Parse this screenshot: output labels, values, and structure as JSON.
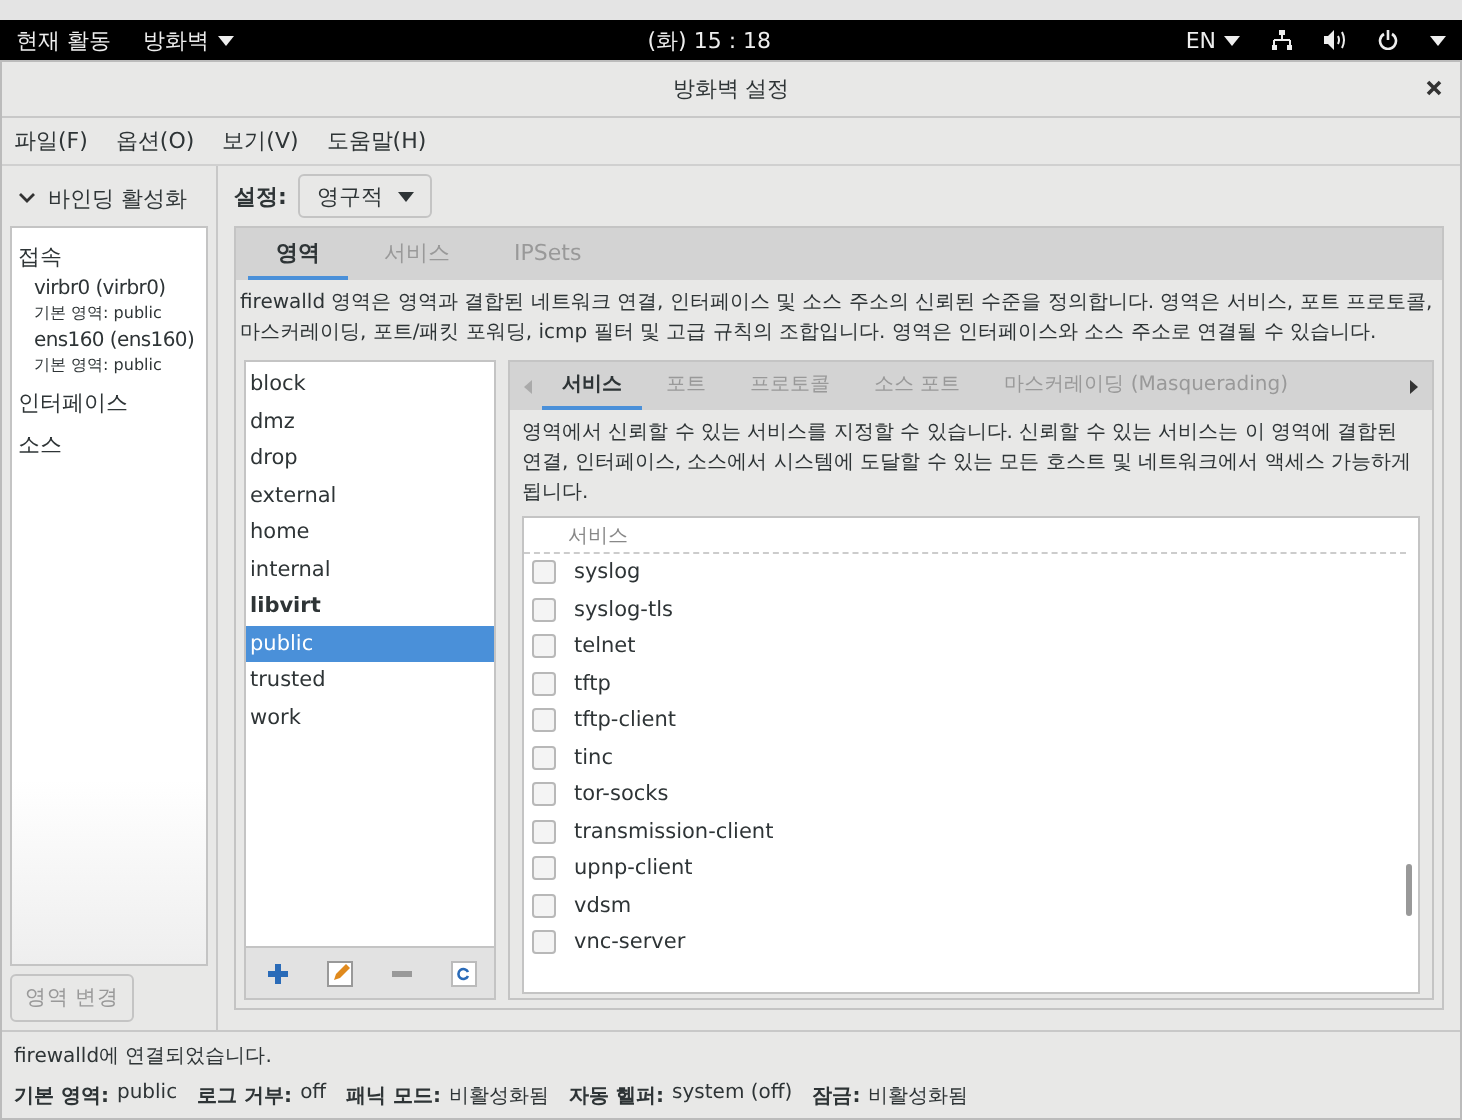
{
  "top_bar": {
    "activities": "현재 활동",
    "app": "방화벽",
    "clock": "(화) 15 : 18",
    "lang": "EN"
  },
  "window": {
    "title": "방화벽 설정"
  },
  "menu": [
    "파일(F)",
    "옵션(O)",
    "보기(V)",
    "도움말(H)"
  ],
  "binding": {
    "label": "바인딩 활성화",
    "expanded": true
  },
  "sidebar": [
    {
      "label": "접속",
      "children": [
        {
          "name": "virbr0 (virbr0)",
          "zone_label": "기본 영역:",
          "zone": "public"
        },
        {
          "name": "ens160 (ens160)",
          "zone_label": "기본 영역:",
          "zone": "public"
        }
      ]
    },
    {
      "label": "인터페이스"
    },
    {
      "label": "소스"
    }
  ],
  "change_zone_button": {
    "label": "영역 변경",
    "disabled": true
  },
  "config": {
    "label": "설정:",
    "value": "영구적"
  },
  "tabs": [
    {
      "label": "영역",
      "selected": true
    },
    {
      "label": "서비스",
      "selected": false
    },
    {
      "label": "IPSets",
      "selected": false
    }
  ],
  "zones_description": "firewalld 영역은 영역과 결합된 네트워크 연결, 인터페이스 및 소스 주소의 신뢰된 수준을 정의합니다. 영역은 서비스, 포트 프로토콜, 마스커레이딩, 포트/패킷 포워딩, icmp 필터 및 고급 규칙의 조합입니다. 영역은 인터페이스와 소스 주소로 연결될 수 있습니다.",
  "zones": [
    {
      "name": "block",
      "selected": false,
      "bold": false
    },
    {
      "name": "dmz",
      "selected": false,
      "bold": false
    },
    {
      "name": "drop",
      "selected": false,
      "bold": false
    },
    {
      "name": "external",
      "selected": false,
      "bold": false
    },
    {
      "name": "home",
      "selected": false,
      "bold": false
    },
    {
      "name": "internal",
      "selected": false,
      "bold": false
    },
    {
      "name": "libvirt",
      "selected": false,
      "bold": true
    },
    {
      "name": "public",
      "selected": true,
      "bold": false
    },
    {
      "name": "trusted",
      "selected": false,
      "bold": false
    },
    {
      "name": "work",
      "selected": false,
      "bold": false
    }
  ],
  "zone_tabs": [
    {
      "label": "서비스",
      "selected": true
    },
    {
      "label": "포트",
      "selected": false
    },
    {
      "label": "프로토콜",
      "selected": false
    },
    {
      "label": "소스 포트",
      "selected": false
    },
    {
      "label": "마스커레이딩 (Masquerading)",
      "selected": false
    }
  ],
  "services_description": "영역에서 신뢰할 수 있는 서비스를 지정할 수 있습니다. 신뢰할 수 있는 서비스는 이 영역에 결합된 연결, 인터페이스, 소스에서 시스템에 도달할 수 있는 모든 호스트 및 네트워크에서 액세스 가능하게 됩니다.",
  "services": {
    "column": "서비스",
    "items": [
      {
        "name": "syslog",
        "checked": false
      },
      {
        "name": "syslog-tls",
        "checked": false
      },
      {
        "name": "telnet",
        "checked": false
      },
      {
        "name": "tftp",
        "checked": false
      },
      {
        "name": "tftp-client",
        "checked": false
      },
      {
        "name": "tinc",
        "checked": false
      },
      {
        "name": "tor-socks",
        "checked": false
      },
      {
        "name": "transmission-client",
        "checked": false
      },
      {
        "name": "upnp-client",
        "checked": false
      },
      {
        "name": "vdsm",
        "checked": false
      },
      {
        "name": "vnc-server",
        "checked": false
      }
    ]
  },
  "status": {
    "message": "firewalld에 연결되었습니다.",
    "fields": [
      {
        "label": "기본 영역:",
        "value": "public"
      },
      {
        "label": "로그 거부:",
        "value": "off"
      },
      {
        "label": "패닉 모드:",
        "value": "비활성화됨"
      },
      {
        "label": "자동 헬퍼:",
        "value": "system (off)"
      },
      {
        "label": "잠금:",
        "value": "비활성화됨"
      }
    ]
  }
}
